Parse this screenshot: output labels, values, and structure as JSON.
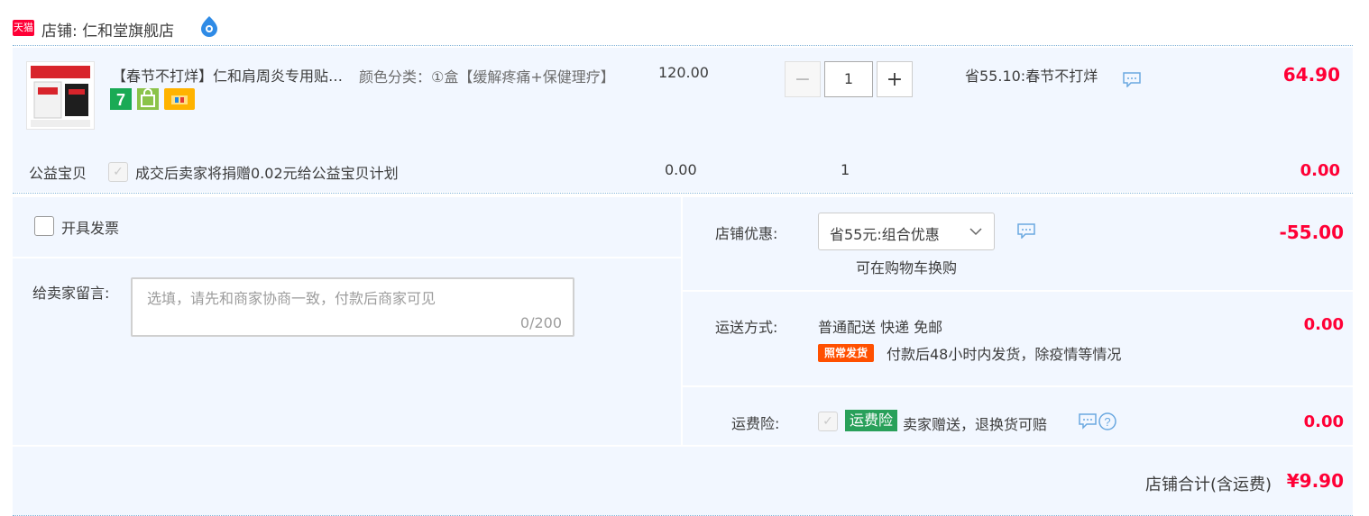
{
  "shop": {
    "platform_badge": "天猫",
    "label": "店铺: 仁和堂旗舰店"
  },
  "item": {
    "title": "【春节不打烊】仁和肩周炎专用贴膏肩颈疼痛贴",
    "image_caption": "一盒装（共6贴）",
    "image_headline": "哪痛贴哪 简单方便",
    "sku": "颜色分类：①盒【缓解疼痛+保健理疗】",
    "unit_price": "120.00",
    "quantity": "1",
    "minus": "−",
    "plus": "+",
    "promo": "省55.10:春节不打烊",
    "total": "64.90",
    "service_icons": [
      "seven-day-return-icon",
      "shopping-bag-icon",
      "credit-card-icon"
    ]
  },
  "charity": {
    "label": "公益宝贝",
    "check": "✓",
    "text": "成交后卖家将捐赠0.02元给公益宝贝计划",
    "price": "0.00",
    "quantity": "1",
    "total": "0.00"
  },
  "invoice": {
    "label": "开具发票"
  },
  "message": {
    "label": "给卖家留言:",
    "placeholder": "选填，请先和商家协商一致，付款后商家可见",
    "count": "0/200"
  },
  "discount": {
    "label": "店铺优惠:",
    "selected": "省55元:组合优惠",
    "note": "可在购物车换购",
    "amount": "-55.00"
  },
  "shipping": {
    "label": "运送方式:",
    "method": "普通配送 快递 免邮",
    "badge": "照常发货",
    "note": "付款后48小时内发货，除疫情等情况",
    "amount": "0.00"
  },
  "insurance": {
    "label": "运费险:",
    "check": "✓",
    "badge": "运费险",
    "text": "卖家赠送，退换货可赔",
    "amount": "0.00"
  },
  "summary": {
    "label": "店铺合计(含运费)",
    "total": "¥9.90"
  },
  "colors": {
    "accent_red": "#ff0036",
    "panel_bg": "#f2f7ff",
    "insurance_green": "#29a05a",
    "ship_orange": "#ff5000"
  }
}
